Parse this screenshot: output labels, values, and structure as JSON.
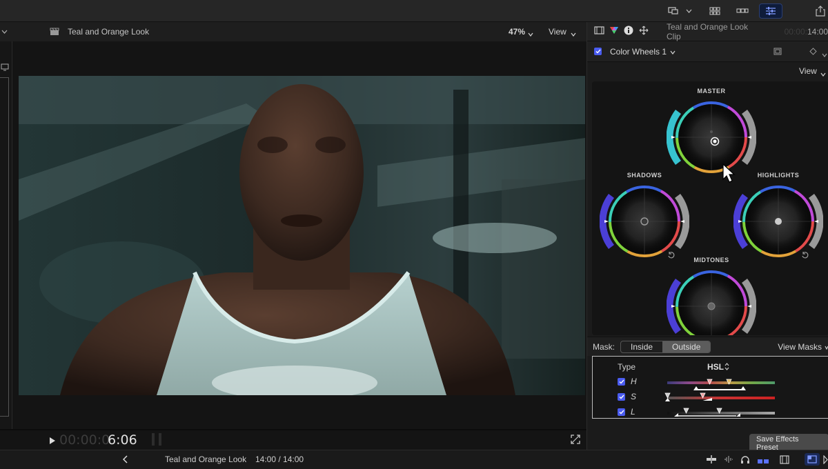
{
  "viewer": {
    "clip_title": "Teal and Orange Look",
    "zoom": "47%",
    "view_label": "View",
    "timecode_dim": "00:00:0",
    "timecode_bright": "6:06"
  },
  "inspector": {
    "clip_name": "Teal and Orange Look Clip",
    "clip_time_dim": "00:00:",
    "clip_time_bright": "14:00",
    "effect_name": "Color Wheels 1",
    "view_label": "View",
    "wheels": {
      "master": "MASTER",
      "shadows": "SHADOWS",
      "highlights": "HIGHLIGHTS",
      "midtones": "MIDTONES"
    },
    "mask": {
      "label": "Mask:",
      "inside": "Inside",
      "outside": "Outside",
      "selected": "Outside",
      "view_masks": "View Masks"
    },
    "hsl": {
      "type_label": "Type",
      "type_value": "HSL",
      "rows": [
        {
          "label": "H",
          "checked": true
        },
        {
          "label": "S",
          "checked": true
        },
        {
          "label": "L",
          "checked": true
        }
      ]
    },
    "save_preset": "Save Effects Preset"
  },
  "bottom": {
    "project_name": "Teal and Orange Look",
    "duration": "14:00 / 14:00"
  },
  "colors": {
    "accent": "#4a5cf0",
    "toolbar_active": "#2a3e73"
  }
}
